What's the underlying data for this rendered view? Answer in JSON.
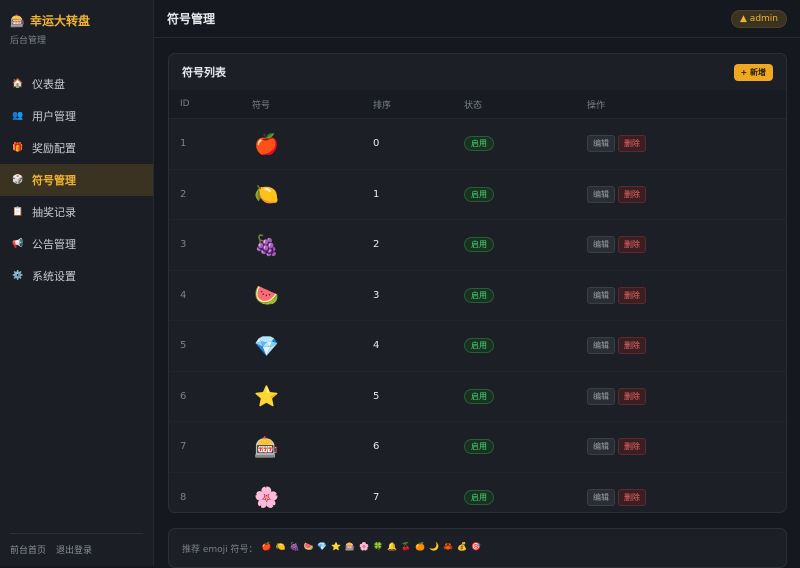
{
  "brand": {
    "icon": "🎰",
    "title": "幸运大转盘",
    "subtitle": "后台管理"
  },
  "nav": [
    {
      "icon": "🏠",
      "label": "仪表盘",
      "active": false
    },
    {
      "icon": "👥",
      "label": "用户管理",
      "active": false
    },
    {
      "icon": "🎁",
      "label": "奖励配置",
      "active": false
    },
    {
      "icon": "🎲",
      "label": "符号管理",
      "active": true
    },
    {
      "icon": "📋",
      "label": "抽奖记录",
      "active": false
    },
    {
      "icon": "📢",
      "label": "公告管理",
      "active": false
    },
    {
      "icon": "⚙️",
      "label": "系统设置",
      "active": false
    }
  ],
  "footer": {
    "home": "前台首页",
    "logout": "退出登录"
  },
  "topbar": {
    "title": "符号管理",
    "user": "▲ admin"
  },
  "card": {
    "title": "符号列表",
    "add_label": "+ 新增",
    "columns": {
      "id": "ID",
      "symbol": "符号",
      "order": "排序",
      "status": "状态",
      "ops": "操作"
    },
    "rows": [
      {
        "id": "1",
        "symbol": "🍎",
        "order": "0",
        "status": "启用"
      },
      {
        "id": "2",
        "symbol": "🍋",
        "order": "1",
        "status": "启用"
      },
      {
        "id": "3",
        "symbol": "🍇",
        "order": "2",
        "status": "启用"
      },
      {
        "id": "4",
        "symbol": "🍉",
        "order": "3",
        "status": "启用"
      },
      {
        "id": "5",
        "symbol": "💎",
        "order": "4",
        "status": "启用"
      },
      {
        "id": "6",
        "symbol": "⭐",
        "order": "5",
        "status": "启用"
      },
      {
        "id": "7",
        "symbol": "🎰",
        "order": "6",
        "status": "启用"
      },
      {
        "id": "8",
        "symbol": "🌸",
        "order": "7",
        "status": "启用"
      }
    ],
    "edit_label": "编辑",
    "delete_label": "删除"
  },
  "recommend": {
    "label": "推荐 emoji 符号：",
    "items": [
      "🍎",
      "🍋",
      "🍇",
      "🍉",
      "💎",
      "⭐",
      "🎰",
      "🌸",
      "🍀",
      "🔔",
      "🍒",
      "🍊",
      "🌙",
      "🦀",
      "💰",
      "🎯"
    ]
  }
}
